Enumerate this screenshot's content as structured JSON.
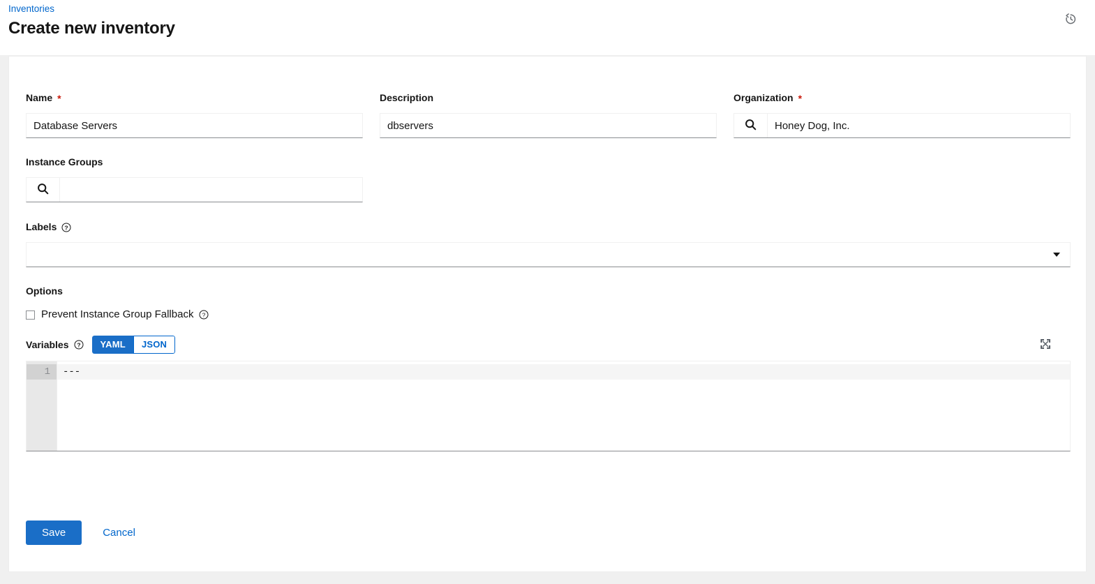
{
  "header": {
    "breadcrumb": "Inventories",
    "title": "Create new inventory",
    "history_icon": "history-icon"
  },
  "form": {
    "name": {
      "label": "Name",
      "required_marker": "*",
      "value": "Database Servers",
      "placeholder": ""
    },
    "description": {
      "label": "Description",
      "value": "dbservers",
      "placeholder": ""
    },
    "organization": {
      "label": "Organization",
      "required_marker": "*",
      "value": "Honey Dog, Inc.",
      "placeholder": "",
      "search_icon": "search-icon"
    },
    "instance_groups": {
      "label": "Instance Groups",
      "value": "",
      "placeholder": "",
      "search_icon": "search-icon"
    },
    "labels": {
      "label": "Labels",
      "help_icon": "question-circle-icon",
      "value": "",
      "caret_icon": "chevron-down-icon"
    },
    "options": {
      "title": "Options",
      "prevent_fallback": {
        "label": "Prevent Instance Group Fallback",
        "checked": false,
        "help_icon": "question-circle-icon"
      }
    },
    "variables": {
      "label": "Variables",
      "help_icon": "question-circle-icon",
      "expand_icon": "expand-arrows-icon",
      "format_options": [
        "YAML",
        "JSON"
      ],
      "selected_format": "YAML",
      "yaml_label": "YAML",
      "json_label": "JSON",
      "editor": {
        "lines": [
          "---"
        ],
        "line_numbers": [
          "1"
        ]
      }
    }
  },
  "actions": {
    "save_label": "Save",
    "cancel_label": "Cancel"
  },
  "colors": {
    "accent_blue": "#1a6ec7",
    "link_blue": "#0066cc",
    "required_red": "#c9190b",
    "page_bg": "#f0f0f0",
    "card_bg": "#ffffff"
  }
}
